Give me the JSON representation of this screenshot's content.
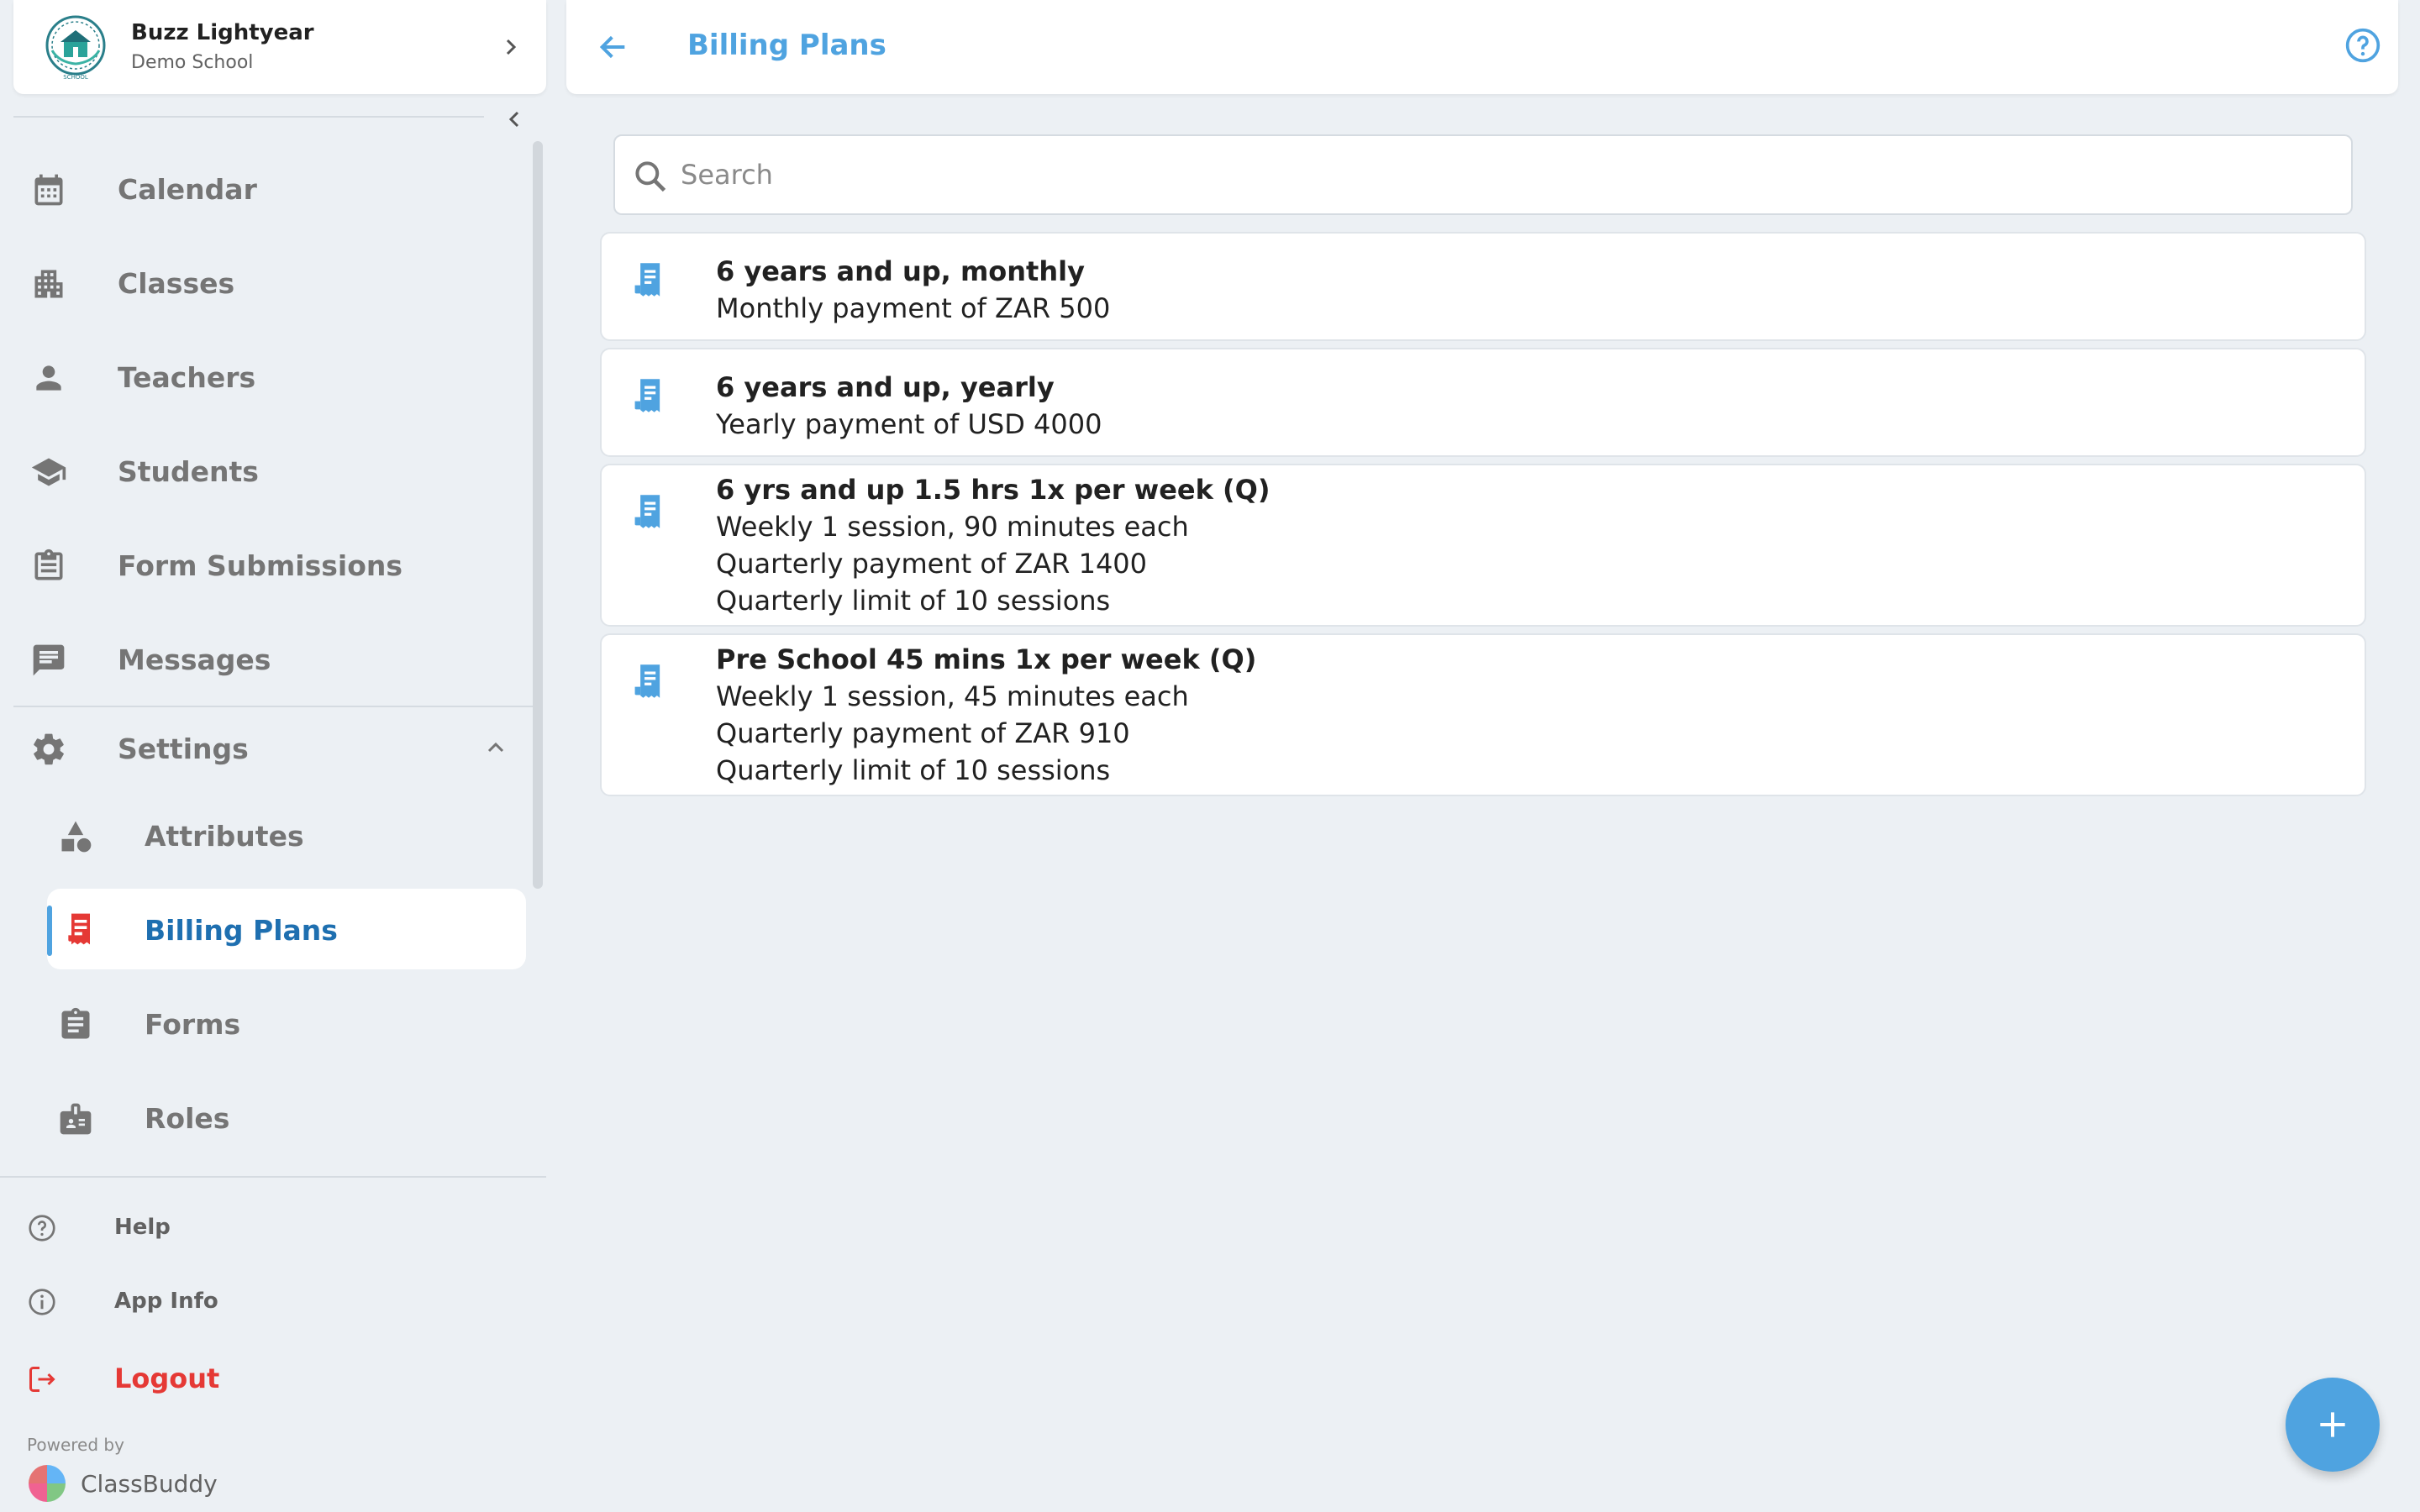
{
  "profile": {
    "name": "Buzz Lightyear",
    "school": "Demo School"
  },
  "nav": [
    {
      "label": "Calendar",
      "icon": "calendar-icon"
    },
    {
      "label": "Classes",
      "icon": "classes-icon"
    },
    {
      "label": "Teachers",
      "icon": "person-icon"
    },
    {
      "label": "Students",
      "icon": "graduation-cap-icon"
    },
    {
      "label": "Form Submissions",
      "icon": "clipboard-list-icon"
    },
    {
      "label": "Messages",
      "icon": "message-icon"
    }
  ],
  "settings": {
    "label": "Settings",
    "icon": "gear-icon",
    "items": [
      {
        "label": "Attributes",
        "icon": "shapes-icon"
      },
      {
        "label": "Billing Plans",
        "icon": "receipt-icon",
        "active": true
      },
      {
        "label": "Forms",
        "icon": "clipboard-icon"
      },
      {
        "label": "Roles",
        "icon": "id-badge-icon"
      }
    ]
  },
  "footer": {
    "help": "Help",
    "app_info": "App Info",
    "logout": "Logout",
    "powered_by": "Powered by",
    "brand": "ClassBuddy"
  },
  "header": {
    "title": "Billing Plans"
  },
  "search": {
    "placeholder": "Search",
    "value": ""
  },
  "plans": [
    {
      "title": "6 years and up, monthly",
      "lines": [
        "Monthly payment of ZAR 500"
      ]
    },
    {
      "title": "6 years and up, yearly",
      "lines": [
        "Yearly payment of USD 4000"
      ]
    },
    {
      "title": "6 yrs and up 1.5 hrs 1x per week (Q)",
      "lines": [
        "Weekly 1 session, 90 minutes each",
        "Quarterly payment of ZAR 1400",
        "Quarterly limit of 10 sessions"
      ]
    },
    {
      "title": "Pre School 45 mins 1x per week (Q)",
      "lines": [
        "Weekly 1 session, 45 minutes each",
        "Quarterly payment of ZAR 910",
        "Quarterly limit of 10 sessions"
      ]
    }
  ],
  "colors": {
    "accent": "#4fa3e0",
    "active_text": "#1e6fb0",
    "logout": "#e53935",
    "background": "#ecf0f4"
  }
}
